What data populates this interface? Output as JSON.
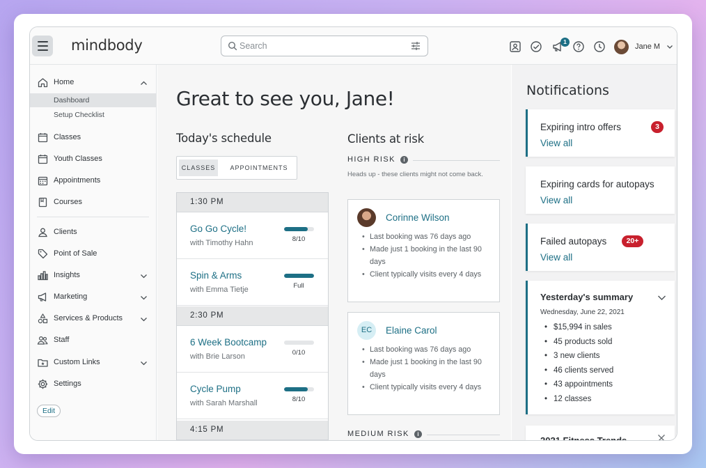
{
  "header": {
    "logo": "mindbody",
    "search_placeholder": "Search",
    "notification_count": "1",
    "user_name": "Jane M"
  },
  "sidebar": {
    "home": "Home",
    "home_sub": [
      "Dashboard",
      "Setup Checklist"
    ],
    "items": [
      "Classes",
      "Youth Classes",
      "Appointments",
      "Courses"
    ],
    "items2": [
      "Clients",
      "Point of Sale",
      "Insights",
      "Marketing",
      "Services & Products",
      "Staff",
      "Custom Links",
      "Settings"
    ],
    "edit_label": "Edit"
  },
  "main": {
    "greeting": "Great to see you, Jane!",
    "schedule_title": "Today's schedule",
    "tabs": [
      "CLASSES",
      "APPOINTMENTS"
    ],
    "schedule": [
      {
        "time": "1:30 PM",
        "classes": [
          {
            "name": "Go Go Cycle!",
            "instructor": "with Timothy Hahn",
            "capacity": "8/10",
            "fill": 0.8
          },
          {
            "name": "Spin & Arms",
            "instructor": "with Emma Tietje",
            "capacity": "Full",
            "fill": 1.0
          }
        ]
      },
      {
        "time": "2:30 PM",
        "classes": [
          {
            "name": "6 Week Bootcamp",
            "instructor": "with Brie Larson",
            "capacity": "0/10",
            "fill": 0.0
          },
          {
            "name": "Cycle Pump",
            "instructor": "with Sarah Marshall",
            "capacity": "8/10",
            "fill": 0.8
          }
        ]
      },
      {
        "time": "4:15 PM",
        "classes": []
      }
    ],
    "clients_title": "Clients at risk",
    "high_risk_label": "HIGH RISK",
    "medium_risk_label": "MEDIUM RISK",
    "high_risk_note": "Heads up - these clients might not come back.",
    "clients": [
      {
        "name": "Corinne Wilson",
        "initials": "",
        "notes": [
          "Last booking was 76 days ago",
          "Made just 1 booking in the last 90 days",
          "Client typically visits every 4 days"
        ]
      },
      {
        "name": "Elaine Carol",
        "initials": "EC",
        "notes": [
          "Last booking was 76 days ago",
          "Made just 1 booking in the last 90 days",
          "Client typically visits every 4 days"
        ]
      }
    ]
  },
  "notifications": {
    "title": "Notifications",
    "cards": [
      {
        "title": "Expiring intro offers",
        "link": "View all",
        "badge": "3"
      },
      {
        "title": "Expiring cards for autopays",
        "link": "View all",
        "badge": ""
      },
      {
        "title": "Failed autopays",
        "link": "View all",
        "badge": "20+"
      }
    ],
    "summary": {
      "title": "Yesterday's summary",
      "date": "Wednesday, June 22, 2021",
      "items": [
        "$15,994 in sales",
        "45 products sold",
        "3 new clients",
        "46 clients served",
        "43 appointments",
        "12 classes"
      ]
    },
    "next_card_title": "2021 Fitness Trends"
  },
  "colors": {
    "accent": "#1d6f85",
    "badge_red": "#c8202d",
    "text_dark": "#2b2f33"
  }
}
